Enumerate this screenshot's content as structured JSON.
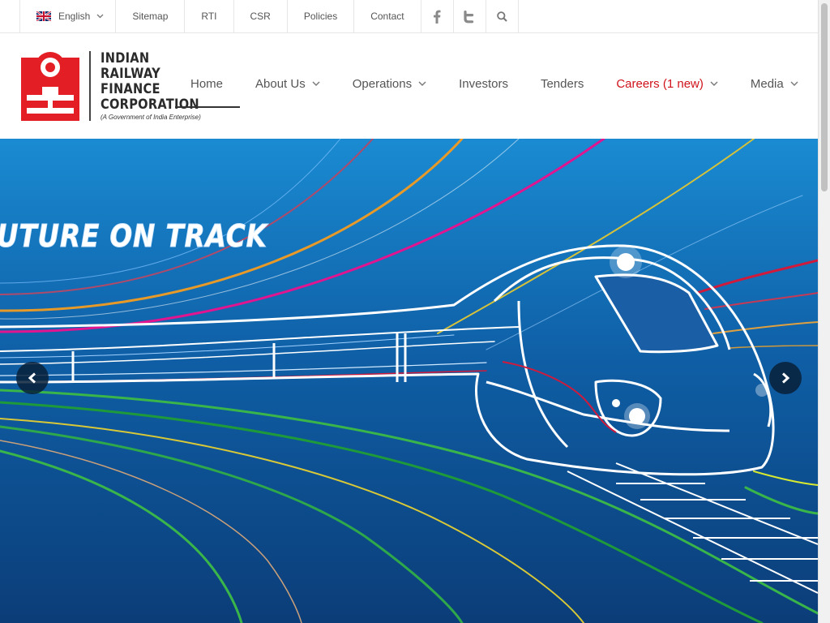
{
  "topbar": {
    "language": {
      "label": "English",
      "flag": "uk-flag-icon"
    },
    "links": [
      "Sitemap",
      "RTI",
      "CSR",
      "Policies",
      "Contact"
    ],
    "icons": [
      "facebook-icon",
      "twitter-icon",
      "search-icon"
    ]
  },
  "logo": {
    "lines": [
      "INDIAN",
      "RAILWAY",
      "FINANCE",
      "CORPORATION"
    ],
    "tagline": "(A Government of India Enterprise)",
    "color": "#e31e24"
  },
  "nav": {
    "items": [
      {
        "label": "Home"
      },
      {
        "label": "About Us",
        "dropdown": true
      },
      {
        "label": "Operations",
        "dropdown": true
      },
      {
        "label": "Investors"
      },
      {
        "label": "Tenders"
      },
      {
        "label": "Careers (1 new)",
        "dropdown": true
      },
      {
        "label": "Media",
        "dropdown": true
      }
    ],
    "highlight_color": "#d0121b"
  },
  "hero": {
    "slogan": "UTURE ON TRACK",
    "prev_icon": "chevron-left-icon",
    "next_icon": "chevron-right-icon"
  }
}
